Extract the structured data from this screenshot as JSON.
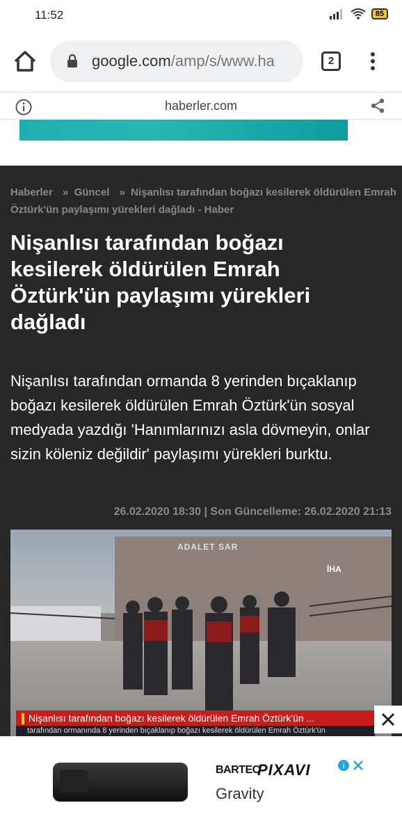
{
  "status_bar": {
    "time": "11:52",
    "battery": "85"
  },
  "browser": {
    "url_host": "google.com",
    "url_path": "/amp/s/www.ha",
    "tab_count": "2"
  },
  "amp_header": {
    "domain": "haberler.com"
  },
  "article": {
    "breadcrumb": {
      "home": "Haberler",
      "sep1": "»",
      "section": "Güncel",
      "sep2": "»",
      "current": "Nişanlısı tarafından boğazı kesilerek öldürülen Emrah Öztürk'ün paylaşımı yürekleri dağladı - Haber"
    },
    "title": "Nişanlısı tarafından boğazı kesilerek öldürülen Emrah Öztürk'ün paylaşımı yürekleri dağladı",
    "summary": "Nişanlısı tarafından ormanda 8 yerinden bıçaklanıp boğazı kesilerek öldürülen Emrah Öztürk'ün sosyal medyada yazdığı 'Hanımlarınızı asla dövmeyin, onlar sizin köleniz değildir' paylaşımı yürekleri burktu.",
    "dates": "26.02.2020 18:30 | Son Güncelleme: 26.02.2020 21:13",
    "image": {
      "sign": "ADALET SAR",
      "agency": "İHA",
      "ticker_main": "Nişanlısı tarafından boğazı kesilerek öldürülen Emrah Öztürk'ün ...",
      "ticker_sub": "tarafından ormanında 8 yerinden bıçaklanıp boğazı kesilerek öldürülen Emrah Öztürk'ün"
    }
  },
  "ad": {
    "brand_a": "BARTEC",
    "brand_b": "PIXAVI",
    "brand_c": "Gravity"
  },
  "colors": {
    "article_bg": "#272727",
    "ad_strip": "#20aeb0",
    "ticker": "#c81d1d"
  }
}
